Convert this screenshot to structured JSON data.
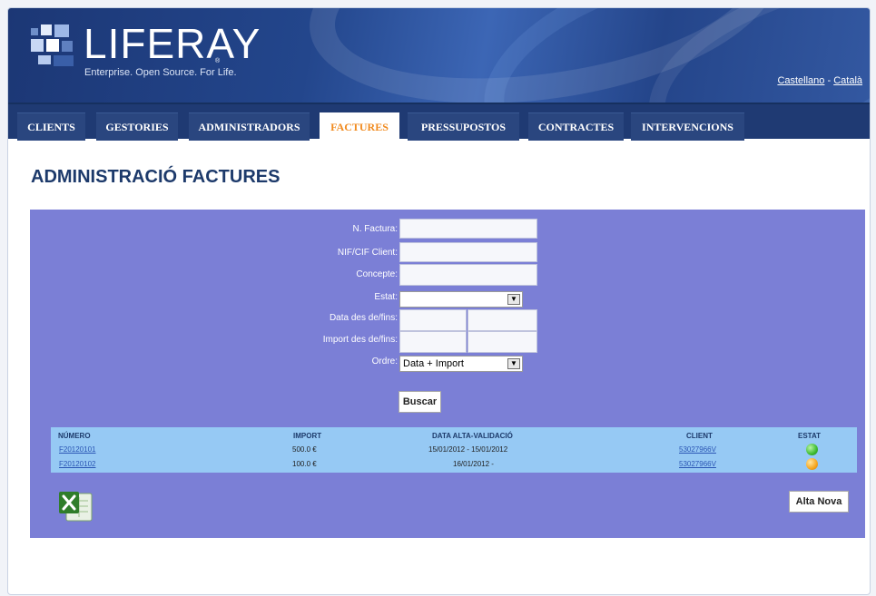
{
  "header": {
    "logo_text": "LIFERAY",
    "logo_reg": "®",
    "tagline": "Enterprise. Open Source. For Life.",
    "lang_castellano": "Castellano",
    "lang_sep": " - ",
    "lang_catala": "Català"
  },
  "nav": {
    "tabs": [
      {
        "label": "CLIENTS"
      },
      {
        "label": "GESTORIES"
      },
      {
        "label": "ADMINISTRADORS"
      },
      {
        "label": "FACTURES"
      },
      {
        "label": "PRESSUPOSTOS"
      },
      {
        "label": "CONTRACTES"
      },
      {
        "label": "INTERVENCIONS"
      }
    ],
    "active": "FACTURES"
  },
  "page": {
    "title": "ADMINISTRACIÓ FACTURES"
  },
  "form": {
    "n_factura_label": "N. Factura:",
    "nif_label": "NIF/CIF Client:",
    "concepte_label": "Concepte:",
    "estat_label": "Estat:",
    "estat_value": "",
    "data_label": "Data des de/fins:",
    "import_label": "Import des de/fins:",
    "ordre_label": "Ordre:",
    "ordre_value": "Data + Import",
    "search_button": "Buscar"
  },
  "results": {
    "columns": [
      "NÚMERO",
      "IMPORT",
      "DATA ALTA-VALIDACIÓ",
      "CLIENT",
      "ESTAT"
    ],
    "rows": [
      {
        "numero": "F20120101",
        "import": "500.0 €",
        "data": "15/01/2012 - 15/01/2012",
        "client": "53027966V",
        "estat": "green"
      },
      {
        "numero": "F20120102",
        "import": "100.0 €",
        "data": "16/01/2012 -",
        "client": "53027966V",
        "estat": "orange"
      }
    ]
  },
  "actions": {
    "new_button": "Alta Nova",
    "excel_icon": "excel-icon"
  },
  "colors": {
    "panel": "#7b7fd6",
    "table": "#96c9f4",
    "nav": "#1f3a73",
    "active_tab_text": "#f18a1e",
    "title": "#1d3a6b",
    "status_green": "#3dbb2f",
    "status_orange": "#f5a51d"
  }
}
